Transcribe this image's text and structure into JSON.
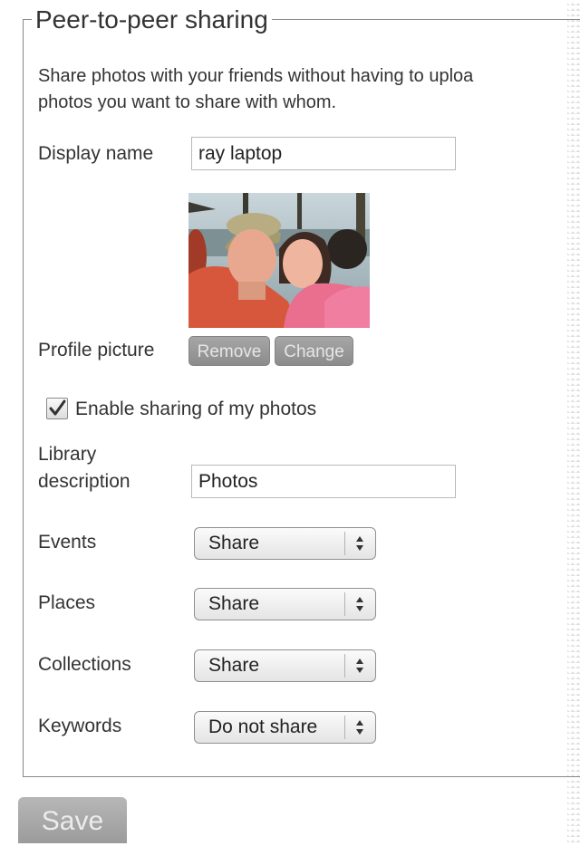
{
  "section": {
    "title": "Peer-to-peer sharing",
    "intro_line1": "Share photos with your friends without having to uploa",
    "intro_line2": "photos you want to share with whom."
  },
  "display_name": {
    "label": "Display name",
    "value": "ray laptop"
  },
  "profile_picture": {
    "label": "Profile picture",
    "remove_label": "Remove",
    "change_label": "Change"
  },
  "enable_sharing": {
    "label": "Enable sharing of my photos",
    "checked": true
  },
  "library_description": {
    "label_line1": "Library",
    "label_line2": "description",
    "value": "Photos"
  },
  "shares": [
    {
      "label": "Events",
      "value": "Share"
    },
    {
      "label": "Places",
      "value": "Share"
    },
    {
      "label": "Collections",
      "value": "Share"
    },
    {
      "label": "Keywords",
      "value": "Do not share"
    }
  ],
  "save_label": "Save"
}
